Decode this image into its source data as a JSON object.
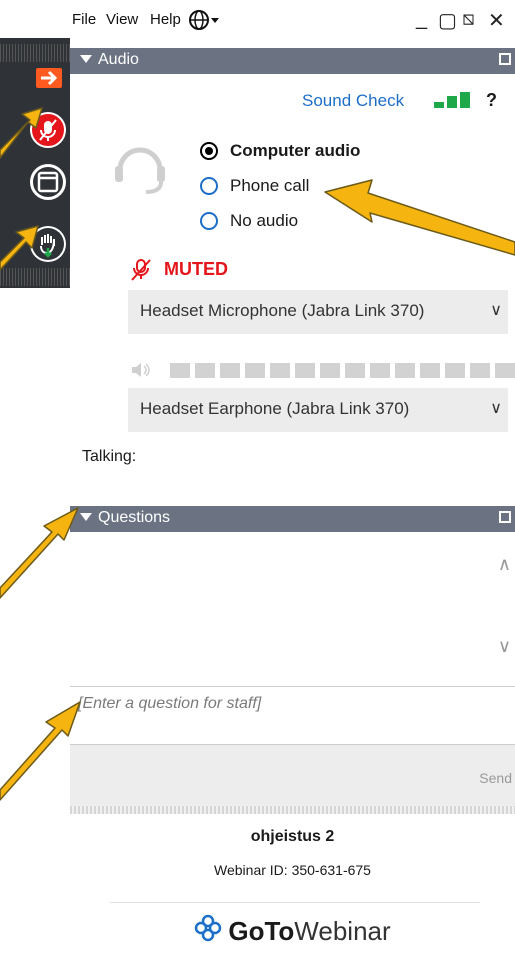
{
  "menu": {
    "file": "File",
    "view": "View",
    "help": "Help"
  },
  "window_controls": {
    "minimize": "_",
    "maximize": "▢",
    "restore": "⧅",
    "close": "✕"
  },
  "audio": {
    "header": "Audio",
    "sound_check": "Sound Check",
    "help_mark": "?",
    "options": [
      {
        "label": "Computer audio",
        "selected": true
      },
      {
        "label": "Phone call",
        "selected": false
      },
      {
        "label": "No audio",
        "selected": false
      }
    ],
    "muted_label": "MUTED",
    "microphone": "Headset Microphone (Jabra Link 370)",
    "speaker": "Headset Earphone (Jabra Link 370)",
    "talking_label": "Talking:",
    "signal_color": "#1fa84a",
    "muted_color": "#e4161b"
  },
  "questions": {
    "header": "Questions",
    "placeholder": "[Enter a question for staff]",
    "send_label": "Send"
  },
  "footer": {
    "webinar_name": "ohjeistus 2",
    "webinar_id": "Webinar ID: 350-631-675",
    "brand_bold": "GoTo",
    "brand_light": "Webinar"
  },
  "colors": {
    "panel_header": "#6b7383",
    "arrow": "#f5b40f",
    "toolbar": "#2f3338",
    "accent_blue": "#1d6ec8"
  }
}
